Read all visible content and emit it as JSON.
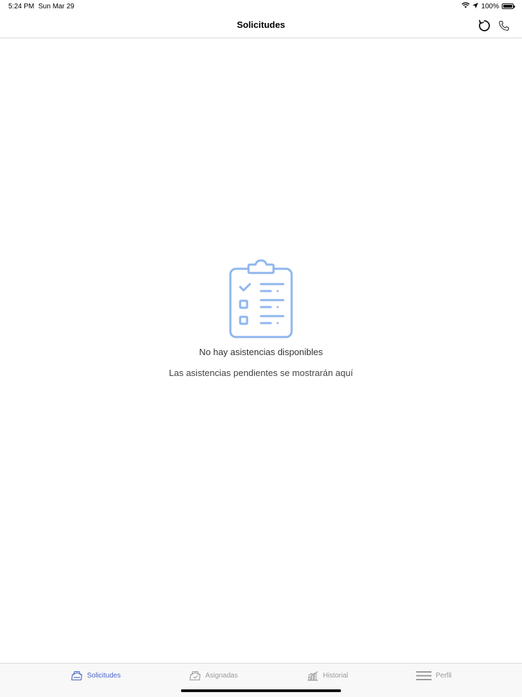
{
  "status_bar": {
    "time": "5:24 PM",
    "date": "Sun Mar 29",
    "battery_text": "100%",
    "battery_level": 1.0,
    "icons": [
      "wifi-icon",
      "location-arrow-icon",
      "battery-icon"
    ]
  },
  "nav": {
    "title": "Solicitudes",
    "actions": [
      "refresh-icon",
      "phone-icon"
    ]
  },
  "empty_state": {
    "icon": "clipboard-checklist-icon",
    "title": "No hay asistencias disponibles",
    "subtitle": "Las asistencias pendientes se mostrarán aquí"
  },
  "tabs": [
    {
      "label": "Solicitudes",
      "icon": "solicitudes-tab-icon",
      "active": true
    },
    {
      "label": "Asignadas",
      "icon": "asignadas-tab-icon",
      "active": false
    },
    {
      "label": "Historial",
      "icon": "chart-icon",
      "active": false
    },
    {
      "label": "Perfil",
      "icon": "menu-lines-icon",
      "active": false
    }
  ],
  "colors": {
    "accent": "#4a64c8",
    "illustration": "#8fb6ee",
    "tab_inactive": "#9a9a9a"
  }
}
